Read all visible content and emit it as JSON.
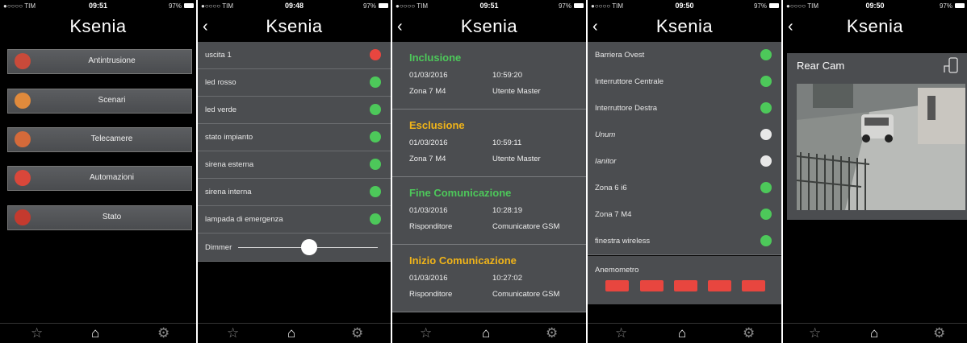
{
  "brand": "Ksenia",
  "screens": [
    {
      "status": {
        "carrier": "●○○○○ TIM",
        "time": "09:51",
        "battery": "97%"
      },
      "menu": [
        {
          "label": "Antintrusione",
          "icon": "lock-icon",
          "color": "#c94a3a"
        },
        {
          "label": "Scenari",
          "icon": "home-icon",
          "color": "#e08a3c"
        },
        {
          "label": "Telecamere",
          "icon": "camera-icon",
          "color": "#d46a3a"
        },
        {
          "label": "Automazioni",
          "icon": "bulb-icon",
          "color": "#d9473a"
        },
        {
          "label": "Stato",
          "icon": "alert-icon",
          "color": "#c43a2e"
        }
      ]
    },
    {
      "status": {
        "carrier": "●○○○○ TIM",
        "time": "09:48",
        "battery": "97%"
      },
      "rows": [
        {
          "label": "uscita 1",
          "state": "red"
        },
        {
          "label": "led rosso",
          "state": "green"
        },
        {
          "label": "led verde",
          "state": "green"
        },
        {
          "label": "stato impianto",
          "state": "green"
        },
        {
          "label": "sirena esterna",
          "state": "green"
        },
        {
          "label": "sirena interna",
          "state": "green"
        },
        {
          "label": "lampada di emergenza",
          "state": "green"
        }
      ],
      "dimmer": {
        "label": "Dimmer",
        "value": 0.48
      }
    },
    {
      "status": {
        "carrier": "●○○○○ TIM",
        "time": "09:51",
        "battery": "97%"
      },
      "events": [
        {
          "title": "Inclusione",
          "color": "#4dc85a",
          "date": "01/03/2016",
          "time": "10:59:20",
          "zone": "Zona 7 M4",
          "user": "Utente Master"
        },
        {
          "title": "Esclusione",
          "color": "#f0b419",
          "date": "01/03/2016",
          "time": "10:59:11",
          "zone": "Zona 7 M4",
          "user": "Utente Master"
        },
        {
          "title": "Fine Comunicazione",
          "color": "#4dc85a",
          "date": "01/03/2016",
          "time": "10:28:19",
          "zone": "Risponditore",
          "user": "Comunicatore GSM"
        },
        {
          "title": "Inizio Comunicazione",
          "color": "#f0b419",
          "date": "01/03/2016",
          "time": "10:27:02",
          "zone": "Risponditore",
          "user": "Comunicatore GSM"
        }
      ]
    },
    {
      "status": {
        "carrier": "●○○○○ TIM",
        "time": "09:50",
        "battery": "97%"
      },
      "rows": [
        {
          "label": "Barriera Ovest",
          "state": "green",
          "italic": false
        },
        {
          "label": "Interruttore Centrale",
          "state": "green",
          "italic": false
        },
        {
          "label": "Interruttore Destra",
          "state": "green",
          "italic": false
        },
        {
          "label": "Unum",
          "state": "white",
          "italic": true
        },
        {
          "label": "Ianitor",
          "state": "white",
          "italic": true
        },
        {
          "label": "Zona 6 i6",
          "state": "green",
          "italic": false
        },
        {
          "label": "Zona 7 M4",
          "state": "green",
          "italic": false
        },
        {
          "label": "finestra wireless",
          "state": "green",
          "italic": false
        }
      ],
      "anemometro": {
        "label": "Anemometro",
        "bars": 5
      }
    },
    {
      "status": {
        "carrier": "●○○○○ TIM",
        "time": "09:50",
        "battery": "97%"
      },
      "cam": {
        "label": "Rear Cam"
      }
    }
  ],
  "tabbar": {
    "icons": [
      "star-icon",
      "home-icon",
      "gear-icon"
    ]
  }
}
